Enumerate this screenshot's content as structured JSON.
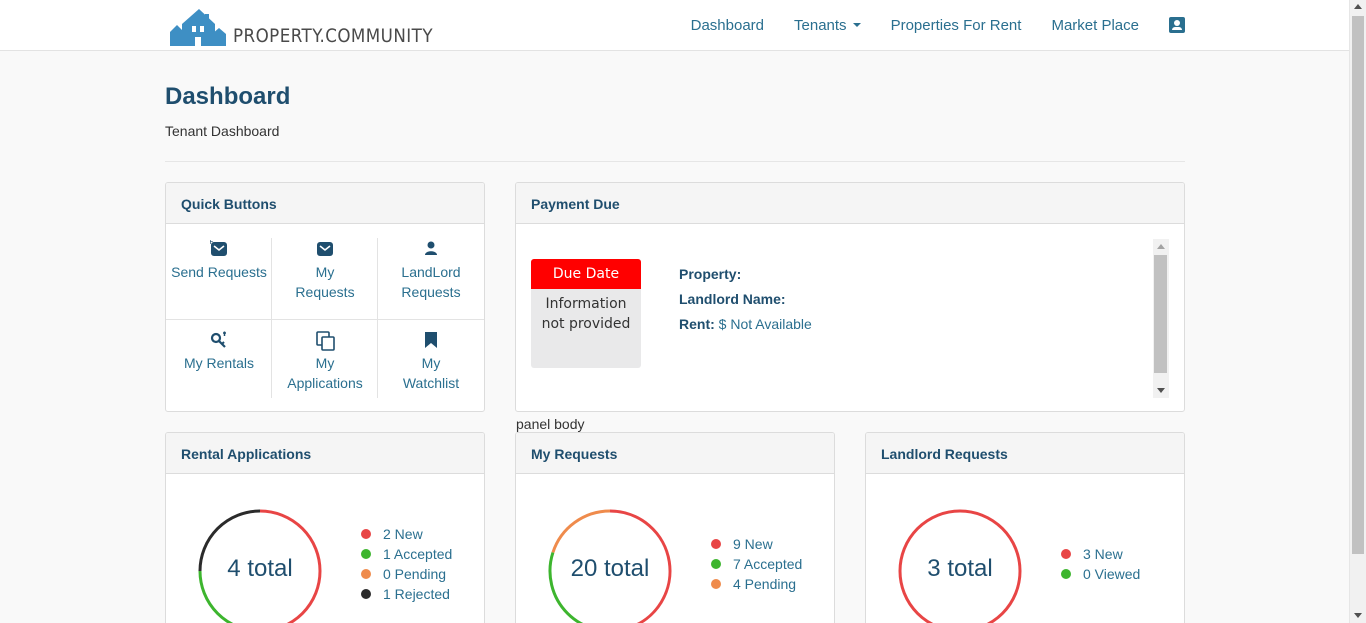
{
  "header": {
    "logo_text": "PROPERTY.COMMUNITY",
    "nav": [
      {
        "label": "Dashboard"
      },
      {
        "label": "Tenants"
      },
      {
        "label": "Properties For Rent"
      },
      {
        "label": "Market Place"
      }
    ],
    "profile_icon": "user-card-icon"
  },
  "page": {
    "title": "Dashboard",
    "subtitle": "Tenant Dashboard"
  },
  "quick_buttons": {
    "title": "Quick Buttons",
    "items": [
      {
        "line1": "Send Requests",
        "line2": "",
        "icon": "envelope-plus-icon"
      },
      {
        "line1": "My",
        "line2": "Requests",
        "icon": "envelope-icon"
      },
      {
        "line1": "LandLord",
        "line2": "Requests",
        "icon": "user-icon"
      },
      {
        "line1": "My Rentals",
        "line2": "",
        "icon": "key-icon"
      },
      {
        "line1": "My",
        "line2": "Applications",
        "icon": "copy-icon"
      },
      {
        "line1": "My",
        "line2": "Watchlist",
        "icon": "bookmark-icon"
      }
    ]
  },
  "payment_due": {
    "title": "Payment Due",
    "due_date_label": "Due Date",
    "due_date_value_1": "Information",
    "due_date_value_2": "not provided",
    "property_label": "Property:",
    "property_value": "",
    "landlord_label": "Landlord Name:",
    "landlord_value": "",
    "rent_label": "Rent:",
    "rent_value": "$ Not Available"
  },
  "panel_body_text": "panel body",
  "rental_applications": {
    "title": "Rental Applications",
    "total_label": "4 total",
    "segments": [
      {
        "label": "2 New",
        "value": 2,
        "color": "#e84545"
      },
      {
        "label": "1 Accepted",
        "value": 1,
        "color": "#3db52e"
      },
      {
        "label": "0 Pending",
        "value": 0,
        "color": "#ef8b4c"
      },
      {
        "label": "1 Rejected",
        "value": 1,
        "color": "#2b2b2b"
      }
    ]
  },
  "my_requests": {
    "title": "My Requests",
    "total_label": "20 total",
    "segments": [
      {
        "label": "9 New",
        "value": 9,
        "color": "#e84545"
      },
      {
        "label": "7 Accepted",
        "value": 7,
        "color": "#3db52e"
      },
      {
        "label": "4 Pending",
        "value": 4,
        "color": "#ef8b4c"
      }
    ]
  },
  "landlord_requests": {
    "title": "Landlord Requests",
    "total_label": "3 total",
    "segments": [
      {
        "label": "3 New",
        "value": 3,
        "color": "#e84545"
      },
      {
        "label": "0 Viewed",
        "value": 0,
        "color": "#3db52e"
      }
    ]
  },
  "colors": {
    "accent": "#2a6f8f",
    "heading": "#1f4e6e",
    "due_red": "#ff0000"
  }
}
